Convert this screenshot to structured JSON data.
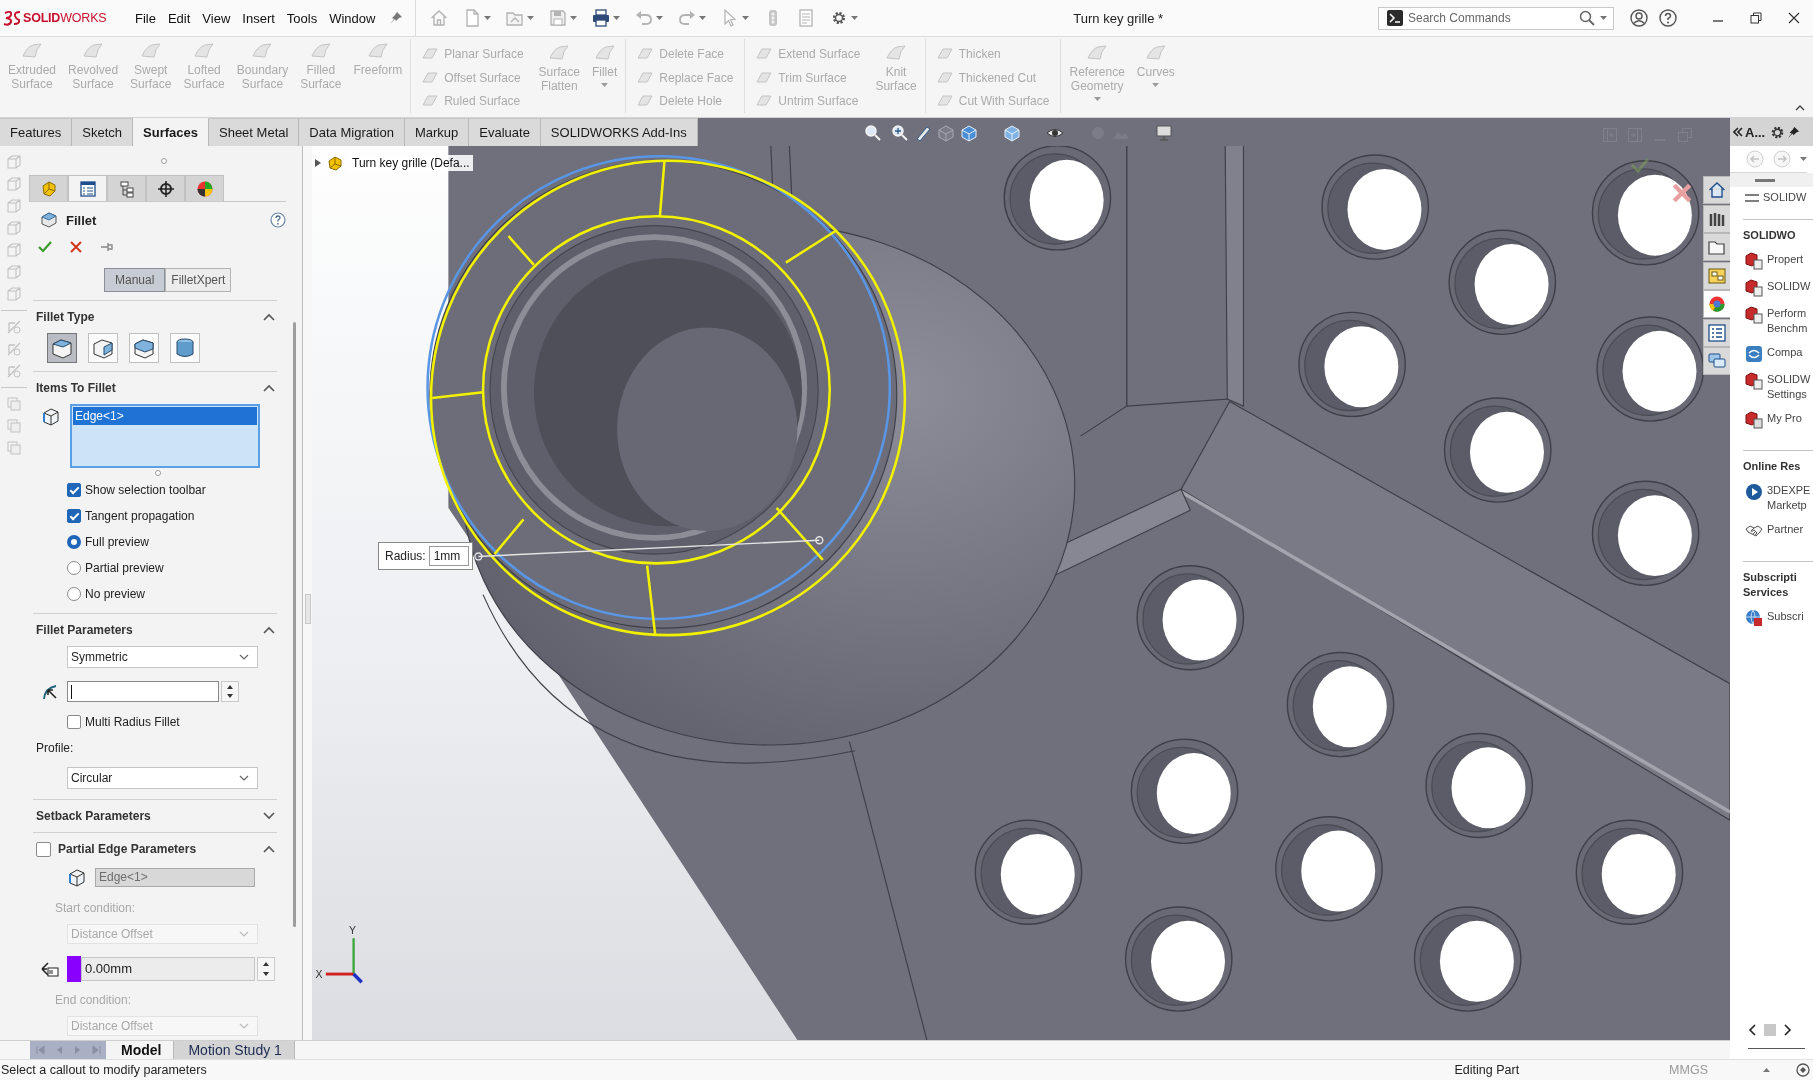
{
  "title_bar": {
    "logo": "**SOLID**WORKS",
    "menus": [
      "File",
      "Edit",
      "View",
      "Insert",
      "Tools",
      "Window"
    ],
    "title": "Turn key grille *",
    "search": {
      "placeholder": "Search Commands"
    }
  },
  "ribbon": {
    "groups": [
      {
        "blocks": [
          {
            "kind": "large",
            "label": "Extruded Surface",
            "disabled": true,
            "dropdown": false
          },
          {
            "kind": "large",
            "label": "Revolved Surface",
            "disabled": true,
            "dropdown": false
          },
          {
            "kind": "large",
            "label": "Swept Surface",
            "disabled": true,
            "dropdown": false
          },
          {
            "kind": "large",
            "label": "Lofted Surface",
            "disabled": true,
            "dropdown": false
          },
          {
            "kind": "large",
            "label": "Boundary Surface",
            "disabled": true,
            "dropdown": false
          },
          {
            "kind": "large",
            "label": "Filled Surface",
            "disabled": true,
            "dropdown": false
          },
          {
            "kind": "large",
            "label": "Freeform",
            "disabled": true,
            "dropdown": false
          }
        ]
      },
      {
        "blocks": [
          {
            "kind": "stack",
            "items": [
              {
                "label": "Planar Surface",
                "disabled": true
              },
              {
                "label": "Offset Surface",
                "disabled": true
              },
              {
                "label": "Ruled Surface",
                "disabled": true
              }
            ]
          },
          {
            "kind": "large",
            "label": "Surface Flatten",
            "disabled": true,
            "dropdown": false
          },
          {
            "kind": "large",
            "label": "Fillet",
            "disabled": true,
            "dropdown": true
          }
        ]
      },
      {
        "blocks": [
          {
            "kind": "stack",
            "items": [
              {
                "label": "Delete Face",
                "disabled": true
              },
              {
                "label": "Replace Face",
                "disabled": true
              },
              {
                "label": "Delete Hole",
                "disabled": true
              }
            ]
          }
        ]
      },
      {
        "blocks": [
          {
            "kind": "stack",
            "items": [
              {
                "label": "Extend Surface",
                "disabled": true
              },
              {
                "label": "Trim Surface",
                "disabled": true
              },
              {
                "label": "Untrim Surface",
                "disabled": true
              }
            ]
          },
          {
            "kind": "large",
            "label": "Knit Surface",
            "disabled": true,
            "dropdown": false
          }
        ]
      },
      {
        "blocks": [
          {
            "kind": "stack",
            "items": [
              {
                "label": "Thicken",
                "disabled": true
              },
              {
                "label": "Thickened Cut",
                "disabled": true
              },
              {
                "label": "Cut With Surface",
                "disabled": true
              }
            ]
          }
        ]
      },
      {
        "blocks": [
          {
            "kind": "large",
            "label": "Reference Geometry",
            "disabled": true,
            "dropdown": true
          },
          {
            "kind": "large",
            "label": "Curves",
            "disabled": true,
            "dropdown": true
          }
        ]
      }
    ]
  },
  "command_tabs": [
    {
      "label": "Features",
      "selected": false
    },
    {
      "label": "Sketch",
      "selected": false
    },
    {
      "label": "Surfaces",
      "selected": true
    },
    {
      "label": "Sheet Metal",
      "selected": false
    },
    {
      "label": "Data Migration",
      "selected": false
    },
    {
      "label": "Markup",
      "selected": false
    },
    {
      "label": "Evaluate",
      "selected": false
    },
    {
      "label": "SOLIDWORKS Add-Ins",
      "selected": false
    }
  ],
  "property_manager": {
    "tabs": [
      {
        "selected": false
      },
      {
        "selected": true
      },
      {
        "selected": false
      },
      {
        "selected": false
      },
      {
        "selected": false
      }
    ],
    "title": "Fillet",
    "modes": [
      {
        "label": "Manual",
        "selected": true
      },
      {
        "label": "FilletXpert",
        "selected": false
      }
    ],
    "sections": [
      {
        "kind": "fillet_type",
        "title": "Fillet Type",
        "expanded": true,
        "types": [
          {
            "selected": true
          },
          {
            "selected": false
          },
          {
            "selected": false
          },
          {
            "selected": false
          }
        ]
      },
      {
        "kind": "items",
        "title": "Items To Fillet",
        "expanded": true,
        "selection": [
          {
            "label": "Edge<1>",
            "selected": true
          }
        ],
        "options": [
          {
            "kind": "checkbox",
            "label": "Show selection toolbar",
            "checked": true
          },
          {
            "kind": "checkbox",
            "label": "Tangent propagation",
            "checked": true
          },
          {
            "kind": "radio",
            "label": "Full preview",
            "selected": true
          },
          {
            "kind": "radio",
            "label": "Partial preview",
            "selected": false
          },
          {
            "kind": "radio",
            "label": "No preview",
            "selected": false
          }
        ]
      },
      {
        "kind": "parameters",
        "title": "Fillet Parameters",
        "expanded": true,
        "method": "Symmetric",
        "radius": {
          "focused": true
        },
        "multi_radius": {
          "label": "Multi Radius Fillet",
          "checked": false
        },
        "profile_label": "Profile:",
        "profile": "Circular"
      },
      {
        "kind": "setback",
        "title": "Setback Parameters",
        "expanded": false
      },
      {
        "kind": "partial_edge",
        "title": "Partial Edge Parameters",
        "expanded": true,
        "checked": false,
        "edge": {
          "value": "Edge<1>",
          "disabled": true
        },
        "start_condition": {
          "label": "Start condition:",
          "value": "Distance Offset",
          "disabled": true
        },
        "offset": {
          "value": "0.00mm"
        },
        "end_condition": {
          "label": "End condition:",
          "value": "Distance Offset",
          "disabled": true
        }
      }
    ]
  },
  "viewport": {
    "tree_flyout": "Turn key grille (Defa...",
    "callout": {
      "label": "Radius:",
      "value": "1mm"
    },
    "triad": {
      "y_label": "Y",
      "x_label": "X"
    }
  },
  "bottom_tabs": [
    {
      "label": "Model",
      "selected": true
    },
    {
      "label": "Motion Study 1",
      "selected": false
    }
  ],
  "task_pane": {
    "title": "A...",
    "tabs": [
      {
        "selected": false
      },
      {
        "selected": false
      },
      {
        "selected": false
      },
      {
        "selected": false
      },
      {
        "selected": true
      },
      {
        "selected": false
      },
      {
        "selected": false
      }
    ],
    "top_item": "SOLIDW",
    "sections": [
      {
        "title_lines": [
          "SOLIDWO"
        ],
        "items": [
          {
            "lines": [
              "Propert"
            ]
          },
          {
            "lines": [
              "SOLIDW"
            ]
          },
          {
            "lines": [
              "Perform",
              "Benchm"
            ]
          },
          {
            "lines": [
              "Compa"
            ]
          },
          {
            "lines": [
              "SOLIDW",
              "Settings"
            ]
          },
          {
            "lines": [
              "My Pro"
            ]
          }
        ]
      },
      {
        "title_lines": [
          "Online Res"
        ],
        "items": [
          {
            "lines": [
              "3DEXPE",
              "Marketp"
            ]
          },
          {
            "lines": [
              "Partner"
            ]
          }
        ]
      },
      {
        "title_lines": [
          "Subscripti",
          "Services"
        ],
        "items": [
          {
            "lines": [
              "Subscri"
            ]
          }
        ]
      }
    ]
  },
  "status_bar": {
    "message": "Select a callout to modify parameters",
    "mode": "Editing Part",
    "units": "MMGS"
  }
}
